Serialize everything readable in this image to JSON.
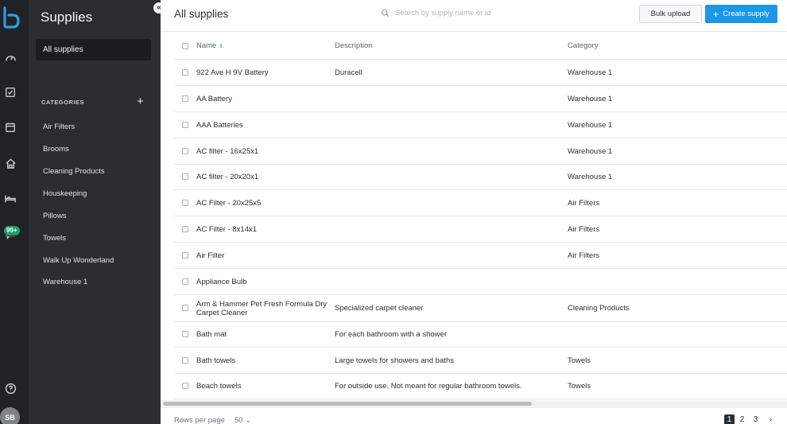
{
  "rail": {
    "icons": [
      "dashboard-icon",
      "checkbox-task-icon",
      "calendar-icon",
      "home-icon",
      "bed-icon",
      "chat-icon",
      "help-icon"
    ],
    "badge": "99+",
    "avatar_initials": "SB"
  },
  "sidebar": {
    "title": "Supplies",
    "all_supplies_label": "All supplies",
    "categories_heading": "CATEGORIES",
    "add_symbol": "+",
    "categories": [
      "Air Filters",
      "Brooms",
      "Cleaning Products",
      "Houskeeping",
      "Pillows",
      "Towels",
      "Walk Up Wonderland",
      "Warehouse 1"
    ]
  },
  "header": {
    "title": "All supplies",
    "search_placeholder": "Search by supply name or id",
    "bulk_upload_label": "Bulk upload",
    "create_supply_label": "Create supply"
  },
  "table": {
    "columns": [
      "Name",
      "Description",
      "Category"
    ],
    "rows": [
      {
        "name": "922 Ave H 9V Battery",
        "description": "Duracell",
        "category": "Warehouse 1"
      },
      {
        "name": "AA Battery",
        "description": "",
        "category": "Warehouse 1"
      },
      {
        "name": "AAA Batteries",
        "description": "",
        "category": "Warehouse 1"
      },
      {
        "name": "AC filter - 16x25x1",
        "description": "",
        "category": "Warehouse 1"
      },
      {
        "name": "AC filter - 20x20x1",
        "description": "",
        "category": "Warehouse 1"
      },
      {
        "name": "AC Filter - 20x25x5",
        "description": "",
        "category": "Air Filters"
      },
      {
        "name": "AC Filter - 8x14x1",
        "description": "",
        "category": "Air Filters"
      },
      {
        "name": "Air Filter",
        "description": "",
        "category": "Air Filters"
      },
      {
        "name": "Appliance Bulb",
        "description": "",
        "category": ""
      },
      {
        "name": "Arm & Hammer Pet Fresh Formula Dry Carpet Cleaner",
        "description": "Specialized carpet cleaner",
        "category": "Cleaning Products"
      },
      {
        "name": "Bath mat",
        "description": "For each bathroom with a shower",
        "category": ""
      },
      {
        "name": "Bath towels",
        "description": "Large towels for showers and baths",
        "category": "Towels"
      },
      {
        "name": "Beach towels",
        "description": "For outside use. Not meant for regular bathroom towels.",
        "category": "Towels"
      }
    ]
  },
  "footer": {
    "rows_per_page_label": "Rows per page",
    "rows_per_page_value": "50",
    "pages": [
      "1",
      "2",
      "3"
    ],
    "active_page": "1"
  },
  "colors": {
    "rail_bg": "#1f2326",
    "sidebar_bg": "#2a2e31",
    "accent": "#1a97e6",
    "badge": "#1f9d6b"
  }
}
